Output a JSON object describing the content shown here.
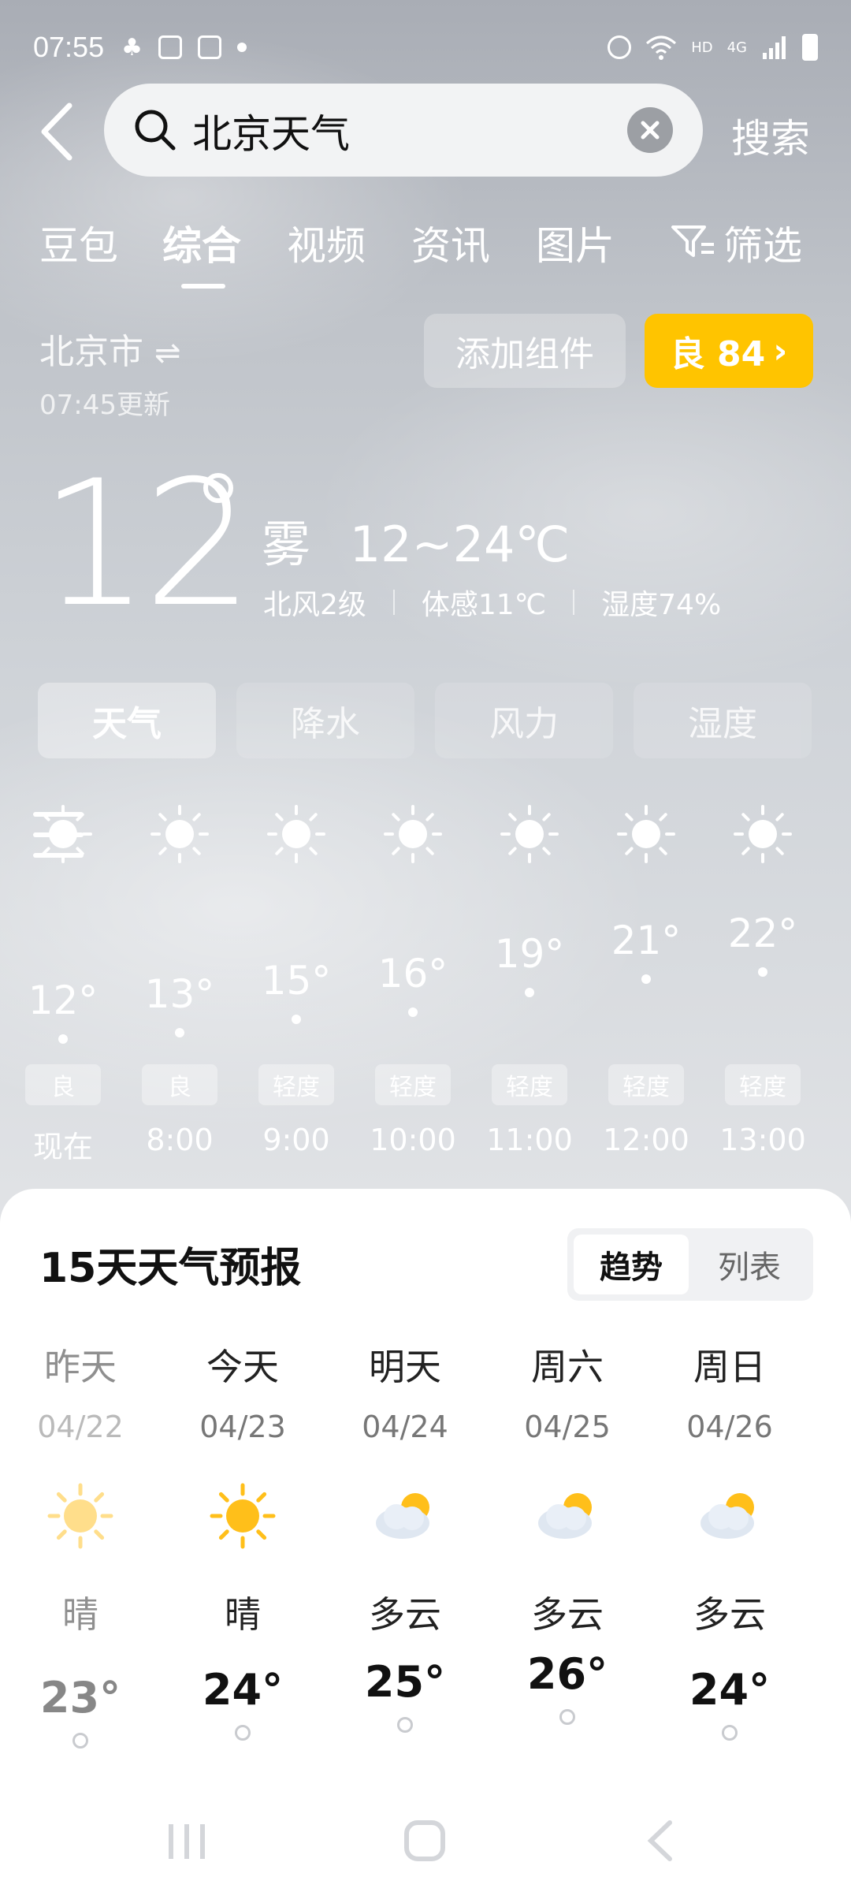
{
  "status_bar": {
    "time": "07:55",
    "network": "HD",
    "network_type": "4G"
  },
  "search": {
    "query": "北京天气",
    "button_label": "搜索"
  },
  "tabs": [
    {
      "label": "豆包"
    },
    {
      "label": "综合",
      "active": true
    },
    {
      "label": "视频"
    },
    {
      "label": "资讯"
    },
    {
      "label": "图片"
    },
    {
      "label": "筛选"
    }
  ],
  "location": {
    "city": "北京市",
    "updated": "07:45更新"
  },
  "buttons": {
    "add_widget": "添加组件",
    "aqi": "良 84"
  },
  "current": {
    "temperature": "12",
    "condition": "雾",
    "range": "12~24℃",
    "wind": "北风2级",
    "feels_like": "体感11℃",
    "humidity": "湿度74%"
  },
  "segments": [
    {
      "label": "天气",
      "active": true
    },
    {
      "label": "降水",
      "active": false
    },
    {
      "label": "风力",
      "active": false
    },
    {
      "label": "湿度",
      "active": false
    }
  ],
  "hourly": [
    {
      "temp": "12°",
      "aqi": "良",
      "time": "现在"
    },
    {
      "temp": "13°",
      "aqi": "良",
      "time": "8:00"
    },
    {
      "temp": "15°",
      "aqi": "轻度",
      "time": "9:00"
    },
    {
      "temp": "16°",
      "aqi": "轻度",
      "time": "10:00"
    },
    {
      "temp": "19°",
      "aqi": "轻度",
      "time": "11:00"
    },
    {
      "temp": "21°",
      "aqi": "轻度",
      "time": "12:00"
    },
    {
      "temp": "22°",
      "aqi": "轻度",
      "time": "13:00"
    }
  ],
  "forecast": {
    "title": "15天天气预报",
    "view_trend": "趋势",
    "view_list": "列表",
    "days": [
      {
        "name": "昨天",
        "date": "04/22",
        "condition": "晴",
        "high": "23°",
        "icon": "sun-icon"
      },
      {
        "name": "今天",
        "date": "04/23",
        "condition": "晴",
        "high": "24°",
        "icon": "sun-icon"
      },
      {
        "name": "明天",
        "date": "04/24",
        "condition": "多云",
        "high": "25°",
        "icon": "cloudy-icon"
      },
      {
        "name": "周六",
        "date": "04/25",
        "condition": "多云",
        "high": "26°",
        "icon": "cloudy-icon"
      },
      {
        "name": "周日",
        "date": "04/26",
        "condition": "多云",
        "high": "24°",
        "icon": "cloudy-icon"
      }
    ]
  },
  "colors": {
    "accent": "#ffc400",
    "sun": "#ffbf1a"
  }
}
